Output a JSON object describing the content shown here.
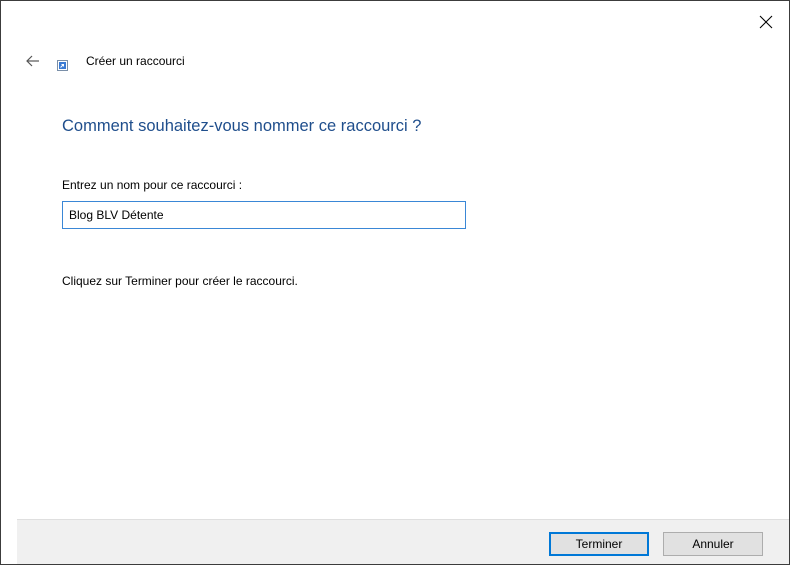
{
  "window": {
    "close_glyph": "✕",
    "close_icon": "close-icon",
    "back_icon": "back-arrow-icon",
    "shortcut_icon": "shortcut-icon"
  },
  "wizard": {
    "title": "Créer un raccourci",
    "heading": "Comment souhaitez-vous nommer ce raccourci ?",
    "name_label": "Entrez un nom pour ce raccourci :",
    "name_value": "Blog BLV Détente",
    "instruction": "Cliquez sur Terminer pour créer le raccourci."
  },
  "footer": {
    "finish_label": "Terminer",
    "cancel_label": "Annuler"
  },
  "colors": {
    "heading": "#1f4e8c",
    "input_border": "#3a87d6",
    "default_button_border": "#0078d7",
    "footer_bg": "#f0f0f0"
  }
}
